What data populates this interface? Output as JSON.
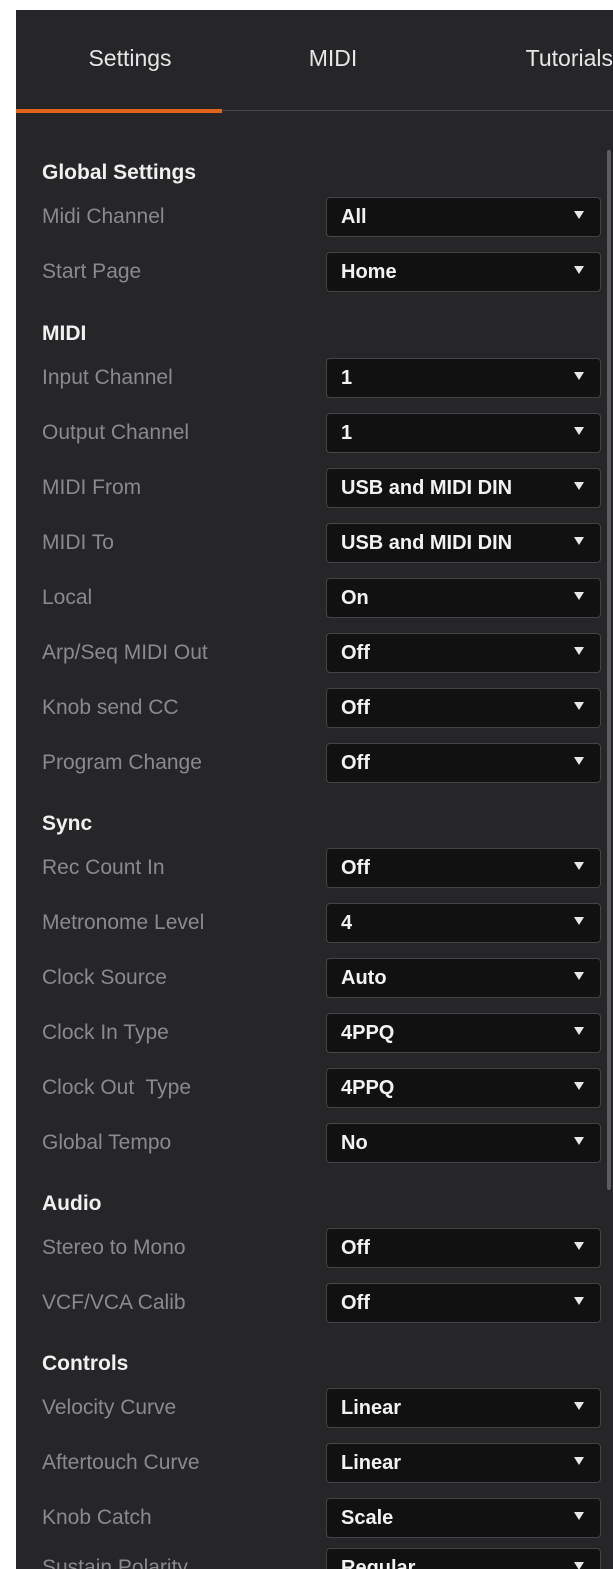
{
  "tabs": {
    "settings": "Settings",
    "midi": "MIDI",
    "tutorials": "Tutorials"
  },
  "accent_color": "#e0621c",
  "sections": {
    "global": "Global Settings",
    "midi": "MIDI",
    "sync": "Sync",
    "audio": "Audio",
    "controls": "Controls"
  },
  "rows": [
    {
      "label": "Midi Channel",
      "value": "All"
    },
    {
      "label": "Start Page",
      "value": "Home"
    },
    {
      "label": "Input Channel",
      "value": "1"
    },
    {
      "label": "Output Channel",
      "value": "1"
    },
    {
      "label": "MIDI From",
      "value": "USB and MIDI DIN"
    },
    {
      "label": "MIDI To",
      "value": "USB and MIDI DIN"
    },
    {
      "label": "Local",
      "value": "On"
    },
    {
      "label": "Arp/Seq MIDI Out",
      "value": "Off"
    },
    {
      "label": "Knob send CC",
      "value": "Off"
    },
    {
      "label": "Program Change",
      "value": "Off"
    },
    {
      "label": "Rec Count In",
      "value": "Off"
    },
    {
      "label": "Metronome Level",
      "value": "4"
    },
    {
      "label": "Clock Source",
      "value": "Auto"
    },
    {
      "label": "Clock In Type",
      "value": "4PPQ"
    },
    {
      "label": "Clock Out  Type",
      "value": "4PPQ"
    },
    {
      "label": "Global Tempo",
      "value": "No"
    },
    {
      "label": "Stereo to Mono",
      "value": "Off"
    },
    {
      "label": "VCF/VCA Calib",
      "value": "Off"
    },
    {
      "label": "Velocity Curve",
      "value": "Linear"
    },
    {
      "label": "Aftertouch Curve",
      "value": "Linear"
    },
    {
      "label": "Knob Catch",
      "value": "Scale"
    },
    {
      "label": "Sustain Polarity",
      "value": "Regular"
    }
  ]
}
